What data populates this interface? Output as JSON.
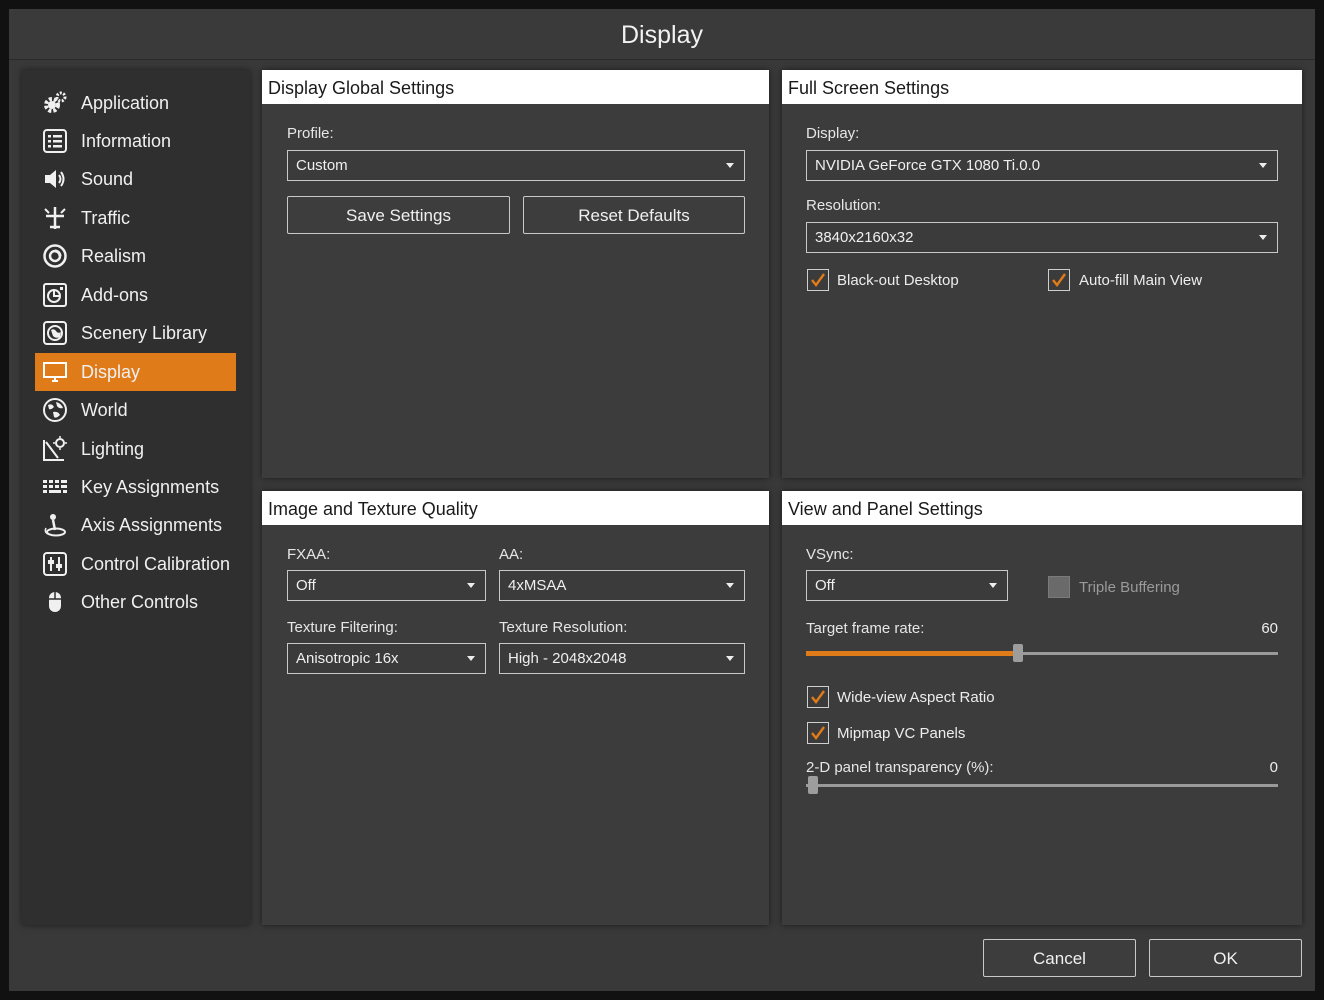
{
  "window": {
    "title": "Display"
  },
  "sidebar": {
    "active": "Display",
    "items": [
      {
        "label": "Application",
        "icon": "gear-icon"
      },
      {
        "label": "Information",
        "icon": "list-icon"
      },
      {
        "label": "Sound",
        "icon": "speaker-icon"
      },
      {
        "label": "Traffic",
        "icon": "traffic-plane-icon"
      },
      {
        "label": "Realism",
        "icon": "realism-icon"
      },
      {
        "label": "Add-ons",
        "icon": "addons-icon"
      },
      {
        "label": "Scenery Library",
        "icon": "globe-map-icon"
      },
      {
        "label": "Display",
        "icon": "monitor-icon"
      },
      {
        "label": "World",
        "icon": "world-icon"
      },
      {
        "label": "Lighting",
        "icon": "lighting-icon"
      },
      {
        "label": "Key Assignments",
        "icon": "keyboard-icon"
      },
      {
        "label": "Axis Assignments",
        "icon": "joystick-icon"
      },
      {
        "label": "Control Calibration",
        "icon": "calibration-icon"
      },
      {
        "label": "Other Controls",
        "icon": "mouse-icon"
      }
    ]
  },
  "global_settings": {
    "title": "Display Global Settings",
    "profile_label": "Profile:",
    "profile_value": "Custom",
    "save_label": "Save Settings",
    "reset_label": "Reset Defaults"
  },
  "fullscreen": {
    "title": "Full Screen Settings",
    "display_label": "Display:",
    "display_value": "NVIDIA GeForce GTX 1080 Ti.0.0",
    "resolution_label": "Resolution:",
    "resolution_value": "3840x2160x32",
    "blackout_label": "Black-out Desktop",
    "blackout_checked": true,
    "autofill_label": "Auto-fill Main View",
    "autofill_checked": true
  },
  "image_quality": {
    "title": "Image and Texture Quality",
    "fxaa_label": "FXAA:",
    "fxaa_value": "Off",
    "aa_label": "AA:",
    "aa_value": "4xMSAA",
    "filtering_label": "Texture Filtering:",
    "filtering_value": "Anisotropic 16x",
    "tex_res_label": "Texture Resolution:",
    "tex_res_value": "High - 2048x2048"
  },
  "view_panel": {
    "title": "View and Panel Settings",
    "vsync_label": "VSync:",
    "vsync_value": "Off",
    "triple_label": "Triple Buffering",
    "triple_checked": false,
    "frame_rate_label": "Target frame rate:",
    "frame_rate_value": "60",
    "frame_rate_fraction": 0.45,
    "wideview_label": "Wide-view Aspect Ratio",
    "wideview_checked": true,
    "mipmap_label": "Mipmap VC Panels",
    "mipmap_checked": true,
    "transparency_label": "2-D panel transparency (%):",
    "transparency_value": "0",
    "transparency_fraction": 0.0
  },
  "footer": {
    "cancel_label": "Cancel",
    "ok_label": "OK"
  },
  "colors": {
    "accent": "#e07b1a",
    "background": "#393939",
    "panel": "#3c3c3c",
    "sidebar": "#2f2f2f",
    "header": "#ffffff"
  }
}
